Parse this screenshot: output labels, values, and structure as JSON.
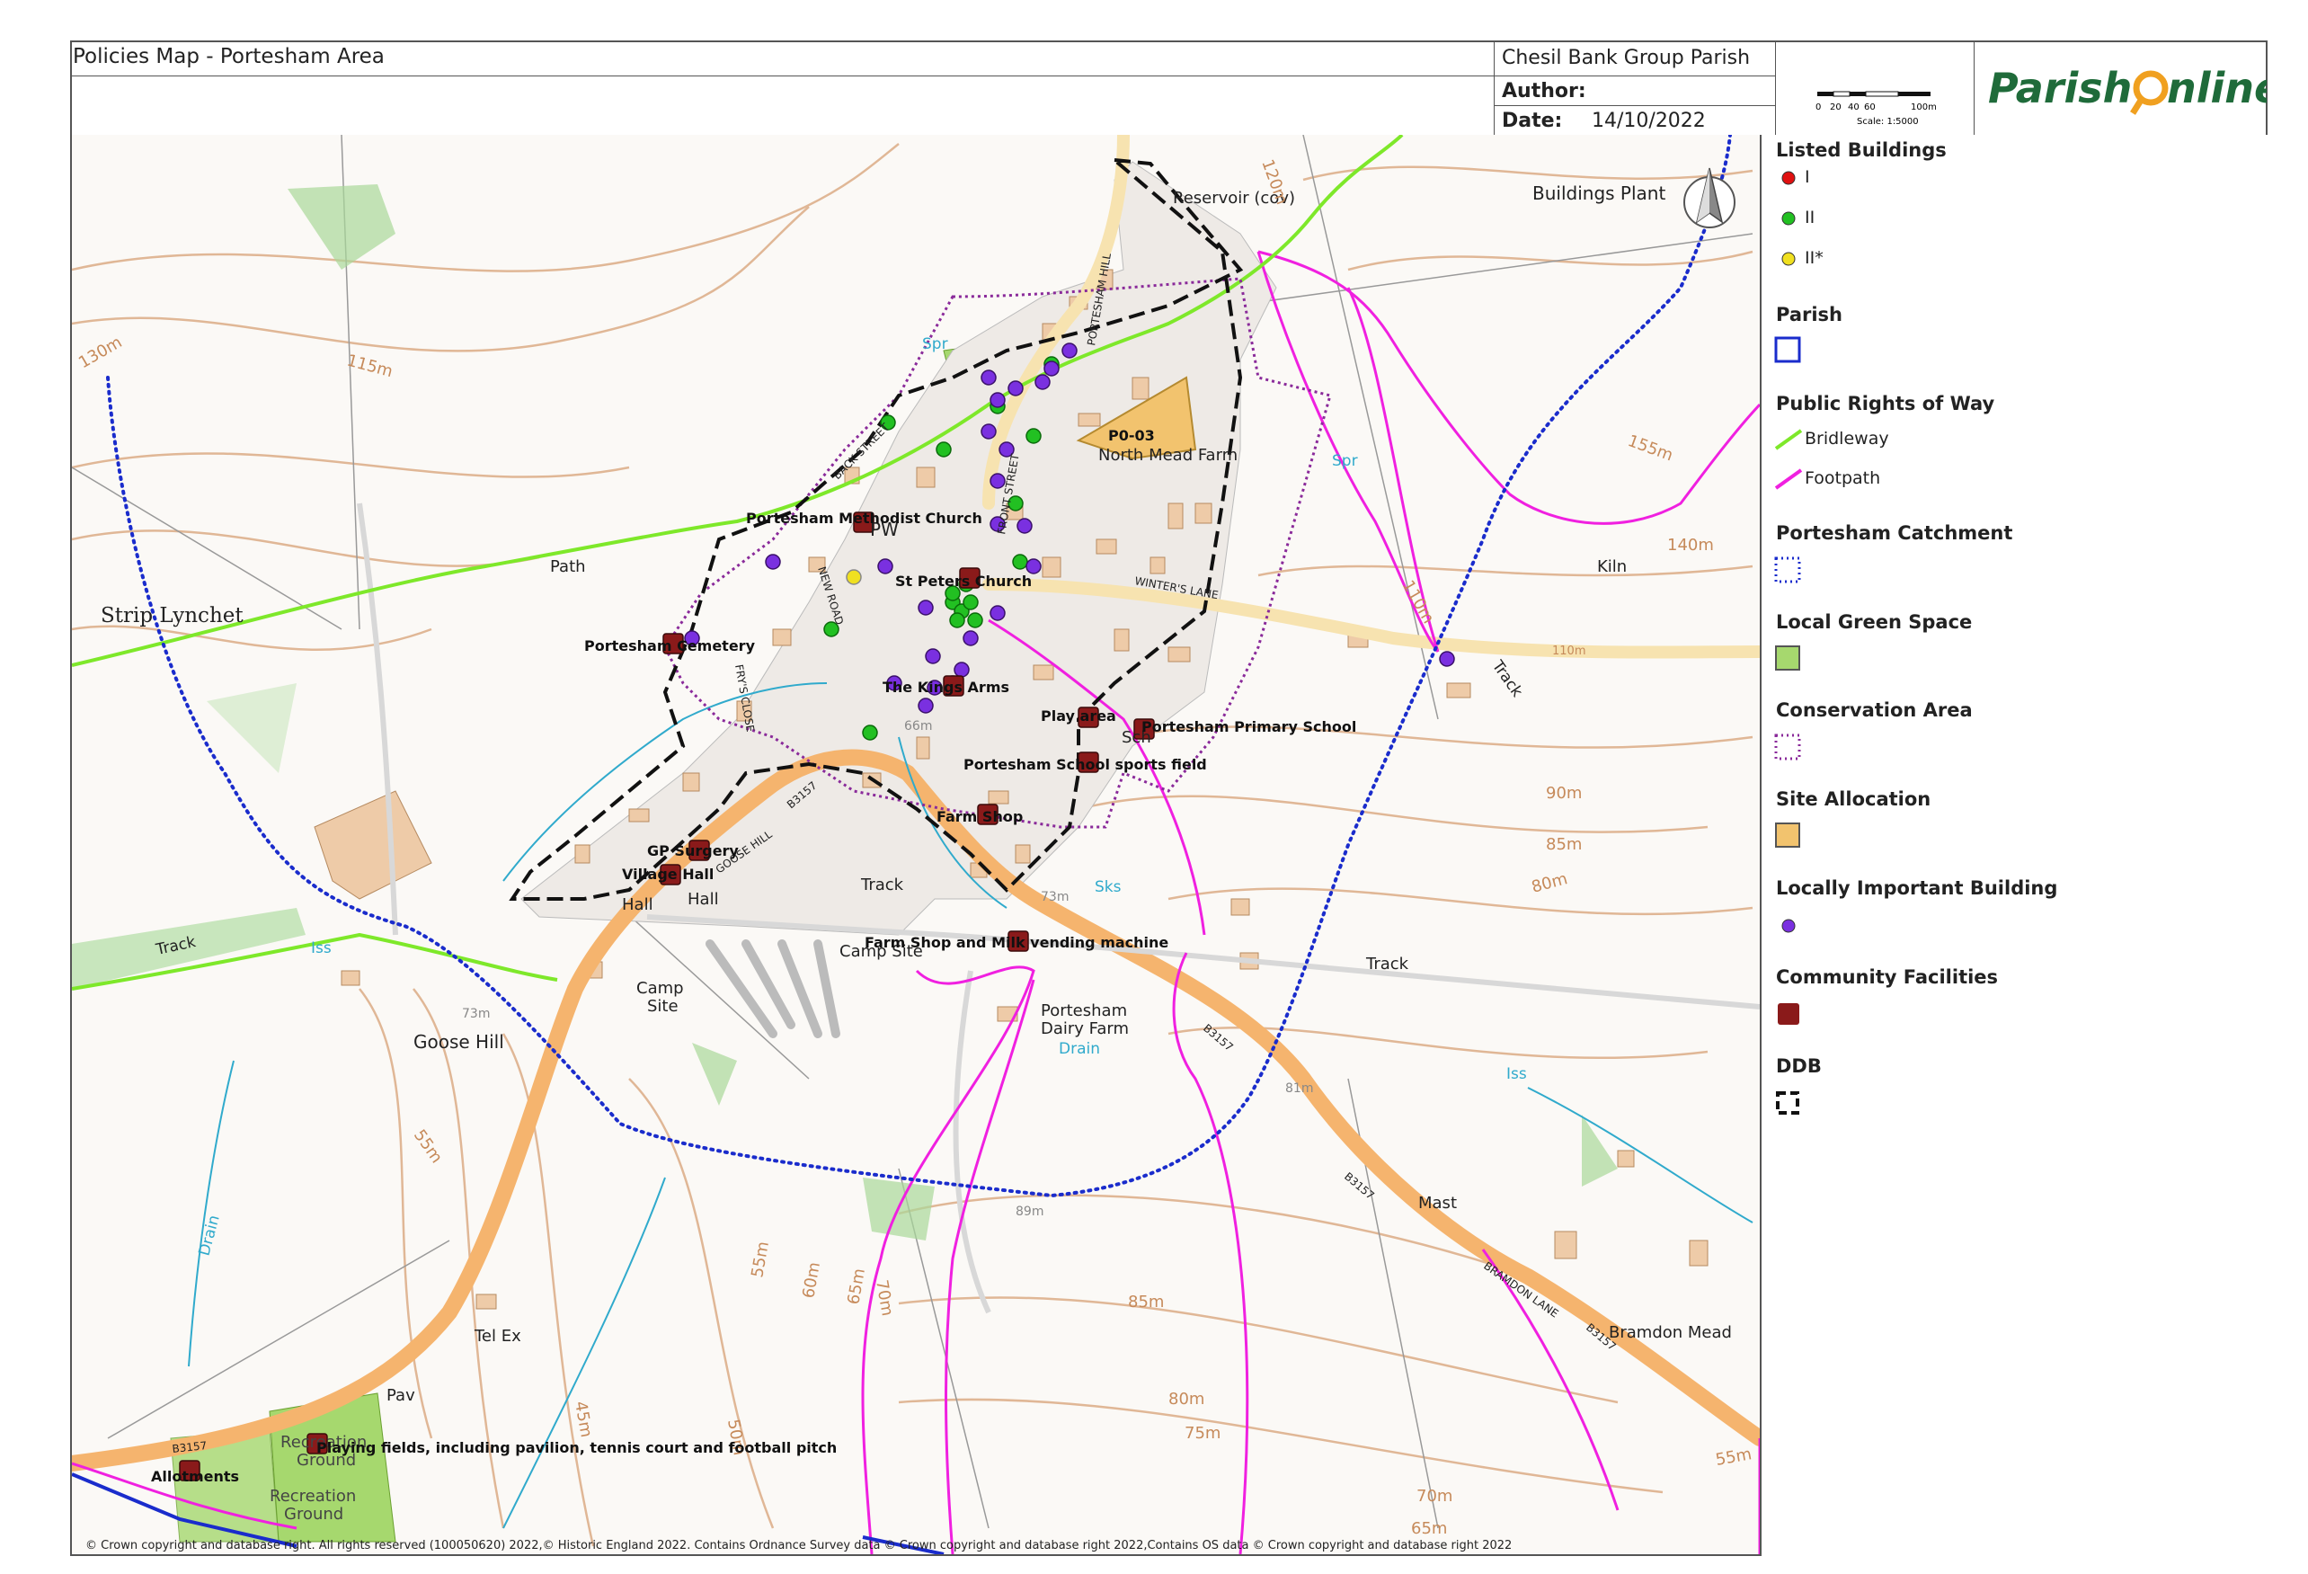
{
  "header": {
    "title": "Policies Map - Portesham Area",
    "parish_name": "Chesil Bank Group Parish",
    "author_label": "Author:",
    "author_value": "",
    "date_label": "Date:",
    "date_value": "14/10/2022",
    "scale_ticks": [
      "0",
      "20",
      "40",
      "60",
      "100m"
    ],
    "scale_text": "Scale: 1:5000",
    "logo_text": "ParishOnline"
  },
  "legend": {
    "sections": [
      {
        "heading": "Listed Buildings",
        "items": [
          {
            "label": "I",
            "color": "#e01010",
            "icon": "dot"
          },
          {
            "label": "II",
            "color": "#22c022",
            "icon": "dot"
          },
          {
            "label": "II*",
            "color": "#f0e020",
            "icon": "dot"
          }
        ]
      },
      {
        "heading": "Parish",
        "items": [
          {
            "label": "",
            "color": "#1a2ccc",
            "icon": "square-outline"
          }
        ]
      },
      {
        "heading": "Public Rights of Way",
        "items": [
          {
            "label": "Bridleway",
            "color": "#7ee82a",
            "icon": "line"
          },
          {
            "label": "Footpath",
            "color": "#f020e0",
            "icon": "line"
          }
        ]
      },
      {
        "heading": "Portesham Catchment",
        "items": [
          {
            "label": "",
            "color": "#1a2ccc",
            "icon": "dotted-square"
          }
        ]
      },
      {
        "heading": "Local Green Space",
        "items": [
          {
            "label": "",
            "color": "#a6d86e",
            "icon": "filled-square"
          }
        ]
      },
      {
        "heading": "Conservation Area",
        "items": [
          {
            "label": "",
            "color": "#8a2a9a",
            "icon": "dotted-square"
          }
        ]
      },
      {
        "heading": "Site Allocation",
        "items": [
          {
            "label": "",
            "color": "#f2c36e",
            "icon": "filled-square"
          }
        ]
      },
      {
        "heading": "Locally Important Building",
        "items": [
          {
            "label": "",
            "color": "#7a30e0",
            "icon": "dot"
          }
        ]
      },
      {
        "heading": "Community Facilities",
        "items": [
          {
            "label": "",
            "color": "#8a1a1a",
            "icon": "facility-icon"
          }
        ]
      },
      {
        "heading": "DDB",
        "items": [
          {
            "label": "",
            "color": "#111111",
            "icon": "dashed-square"
          }
        ]
      }
    ]
  },
  "map": {
    "place_labels": {
      "strip_lynchet": "Strip Lynchet",
      "path": "Path",
      "goose_hill": "Goose Hill",
      "camp_site_1": "Camp",
      "camp_site_2": "Site",
      "camp_site_3": "Camp Site",
      "hall_1": "Hall",
      "hall_2": "Hall",
      "track_1": "Track",
      "track_2": "Track",
      "track_3": "Track",
      "track_4": "Track",
      "tel_ex": "Tel Ex",
      "pav": "Pav",
      "recreation_ground_1": "Recreation",
      "recreation_ground_2": "Ground",
      "recreation_ground_3": "Recreation",
      "recreation_ground_4": "Ground",
      "portesham_dairy_1": "Portesham",
      "portesham_dairy_2": "Dairy Farm",
      "drain_1": "Drain",
      "drain_2": "Drain",
      "iss_1": "Iss",
      "iss_2": "Iss",
      "sks": "Sks",
      "spr_1": "Spr",
      "spr_2": "Spr",
      "reservoir": "Reservoir (cov)",
      "buildings_plantation": "Buildings Plant",
      "kiln": "Kiln",
      "mast": "Mast",
      "bramdon_mead": "Bramdon Mead",
      "north_mead_farm": "North Mead Farm",
      "pw": "PW",
      "sch": "Sch",
      "back_street": "BACK STREET",
      "front_street": "FRONT STREET",
      "new_road": "NEW ROAD",
      "winters_lane": "WINTER'S LANE",
      "goose_hill_road": "GOOSE HILL",
      "bramdon_lane": "BRAMDON LANE",
      "fry_close": "FRY'S CLOSE",
      "portesham_hill": "PORTESHAM HILL",
      "b3157_1": "B3157",
      "b3157_2": "B3157",
      "b3157_3": "B3157",
      "b3157_4": "B3157",
      "b3157_5": "B3157"
    },
    "contour_labels": [
      "130m",
      "115m",
      "120m",
      "155m",
      "140m",
      "110m",
      "110m",
      "90m",
      "85m",
      "80m",
      "55m",
      "45m",
      "50m",
      "55m",
      "60m",
      "65m",
      "70m",
      "85m",
      "80m",
      "75m",
      "70m",
      "65m",
      "55m",
      "89m",
      "81m",
      "66m",
      "73m",
      "73m"
    ],
    "feature_labels": {
      "p0_03": "P0-03",
      "methodist_church": "Portesham Methodist Church",
      "st_peters": "St Peters Church",
      "cemetery": "Portesham Cemetery",
      "kings_arms": "The Kings Arms",
      "play_area": "Play area",
      "primary_school": "Portesham Primary School",
      "school_sports": "Portesham School sports field",
      "farm_shop": "Farm Shop",
      "gp_surgery": "GP Surgery",
      "village_hall": "Village Hall",
      "farm_shop_milk": "Farm Shop and Milk vending machine",
      "playing_fields": "Playing fields, including pavilion, tennis court and football pitch",
      "allotments": "Allotments"
    }
  },
  "copyright": "© Crown copyright and database right. All rights reserved (100050620) 2022,© Historic England 2022. Contains Ordnance Survey data © Crown copyright and database right 2022,Contains OS data © Crown copyright and database right 2022"
}
